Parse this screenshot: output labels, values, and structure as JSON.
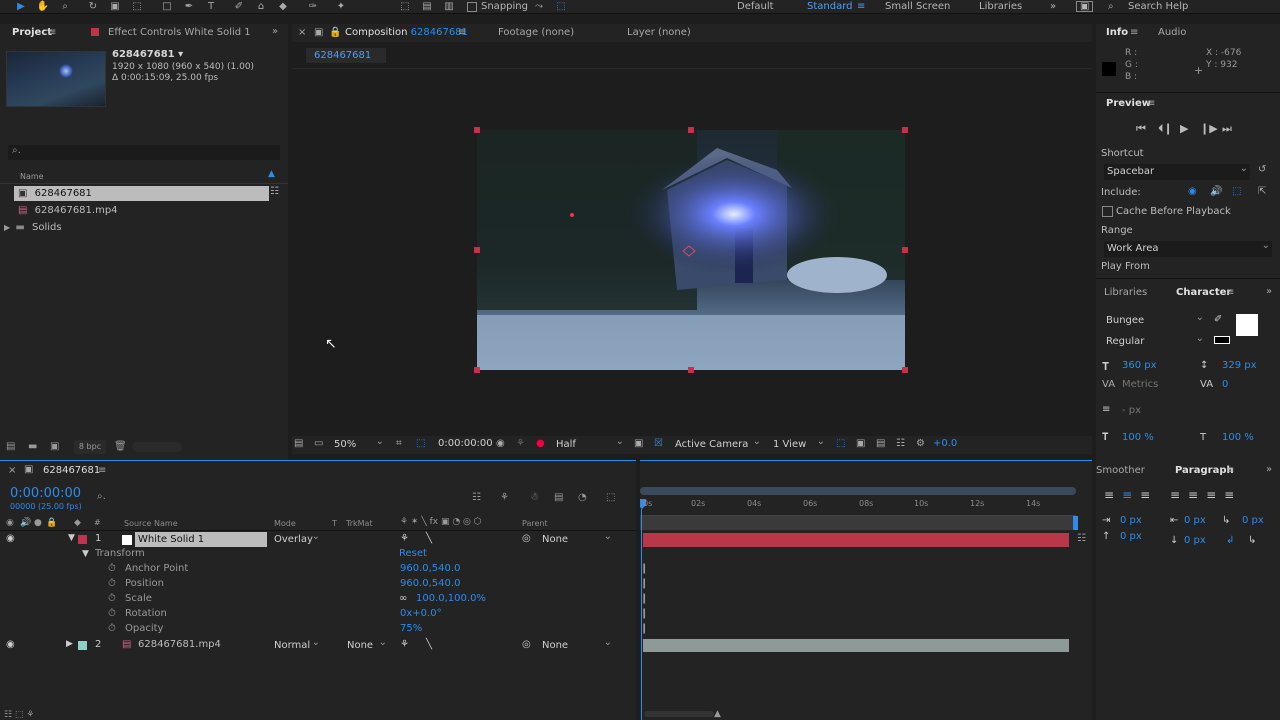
{
  "toolbar": {
    "snapping_label": "Snapping",
    "workspaces": [
      "Default",
      "Standard",
      "Small Screen",
      "Libraries"
    ],
    "search_help": "Search Help"
  },
  "project_panel": {
    "tab_project": "Project",
    "tab_effect_controls": "Effect Controls White Solid 1",
    "item_name": "628467681 ▾",
    "item_meta1": "1920 x 1080 (960 x 540) (1.00)",
    "item_meta2": "Δ 0:00:15:09, 25.00 fps",
    "column_name": "Name",
    "items": [
      "628467681",
      "628467681.mp4",
      "Solids"
    ],
    "bpc": "8 bpc"
  },
  "composition_panel": {
    "tab_label": "Composition",
    "tab_comp_name": "628467681",
    "tab_footage": "Footage (none)",
    "tab_layer": "Layer (none)",
    "breadcrumb": "628467681",
    "zoom": "50%",
    "timecode": "0:00:00:00",
    "resolution": "Half",
    "camera": "Active Camera",
    "views": "1 View",
    "exposure": "+0.0"
  },
  "info_panel": {
    "tab_info": "Info",
    "tab_audio": "Audio",
    "r": "R :",
    "g": "G :",
    "b": "B :",
    "x": "X : -676",
    "y": "Y : 932"
  },
  "preview_panel": {
    "title": "Preview",
    "shortcut_label": "Shortcut",
    "shortcut_value": "Spacebar",
    "include_label": "Include:",
    "cache_label": "Cache Before Playback",
    "range_label": "Range",
    "range_value": "Work Area",
    "play_from_label": "Play From"
  },
  "character_panel": {
    "tab_libraries": "Libraries",
    "tab_character": "Character",
    "font": "Bungee",
    "style": "Regular",
    "size": "360 px",
    "leading": "329 px",
    "kerning": "Metrics",
    "tracking": "0",
    "stroke": "- px",
    "vscale": "100 %",
    "hscale": "100 %"
  },
  "paragraph_panel": {
    "tab_smoother": "Smoother",
    "tab_paragraph": "Paragraph",
    "values": [
      "0 px",
      "0 px",
      "0 px",
      "0 px",
      "0 px"
    ]
  },
  "timeline": {
    "tab_name": "628467681",
    "timecode": "0:00:00:00",
    "timecode_sub": "00000 (25.00 fps)",
    "col_source_name": "Source Name",
    "col_mode": "Mode",
    "col_t": "T",
    "col_trkmat": "TrkMat",
    "col_parent": "Parent",
    "ruler": [
      "0s",
      "02s",
      "04s",
      "06s",
      "08s",
      "10s",
      "12s",
      "14s"
    ],
    "layer1": {
      "num": "1",
      "name": "White Solid 1",
      "mode": "Overlay",
      "parent": "None"
    },
    "transform_label": "Transform",
    "reset_label": "Reset",
    "props": [
      {
        "name": "Anchor Point",
        "value": "960.0,540.0"
      },
      {
        "name": "Position",
        "value": "960.0,540.0"
      },
      {
        "name": "Scale",
        "value": "100.0,100.0%"
      },
      {
        "name": "Rotation",
        "value": "0x+0.0°"
      },
      {
        "name": "Opacity",
        "value": "75%"
      }
    ],
    "layer2": {
      "num": "2",
      "name": "628467681.mp4",
      "mode": "Normal",
      "trkmat": "None",
      "parent": "None"
    }
  },
  "colors": {
    "accent": "#2d8ceb",
    "layer1_bar": "#b8384a",
    "layer2_bar": "#8e9a98",
    "solid_label": "#c0334a"
  }
}
